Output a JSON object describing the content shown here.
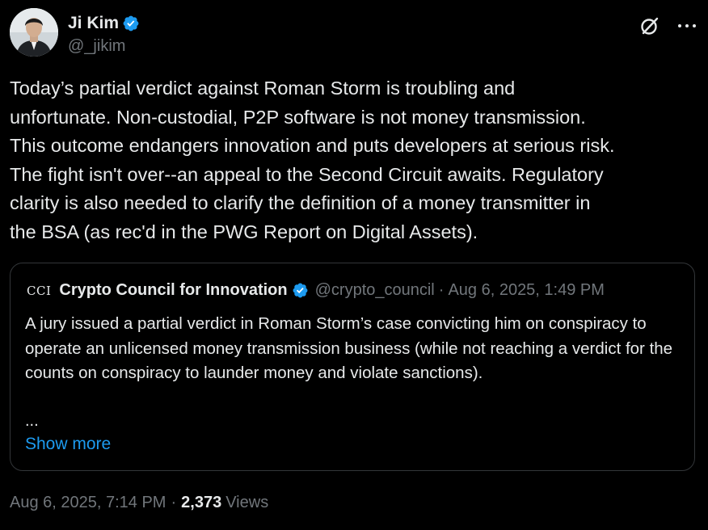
{
  "author": {
    "display_name": "Ji Kim",
    "handle": "@_jikim",
    "verified": true
  },
  "header_icons": [
    "grok-icon",
    "more-icon"
  ],
  "tweet_text": "Today’s partial verdict against Roman Storm is troubling and\nunfortunate. Non-custodial, P2P software is not money transmission.\nThis outcome endangers innovation and puts developers at serious risk.\nThe fight isn't over--an appeal to the Second Circuit awaits. Regulatory\nclarity is also needed to clarify the definition of a money transmitter in\nthe BSA (as rec'd in the PWG Report on Digital Assets).",
  "quote": {
    "logo_text": "CCI",
    "display_name": "Crypto Council for Innovation",
    "handle": "@crypto_council",
    "separator": "·",
    "date": "Aug 6, 2025, 1:49 PM",
    "text": "A jury issued a partial verdict in Roman Storm’s case convicting him on conspiracy to operate an unlicensed money transmission business (while not reaching a verdict for the counts on conspiracy to launder money and violate sanctions).",
    "ellipsis": "...",
    "show_more": "Show more"
  },
  "meta": {
    "timestamp": "Aug 6, 2025, 7:14 PM",
    "separator": "·",
    "views_count": "2,373",
    "views_label": "Views"
  },
  "colors": {
    "background": "#000000",
    "text": "#e7e9ea",
    "secondary": "#71767b",
    "accent": "#1d9bf0",
    "border": "#333639"
  }
}
